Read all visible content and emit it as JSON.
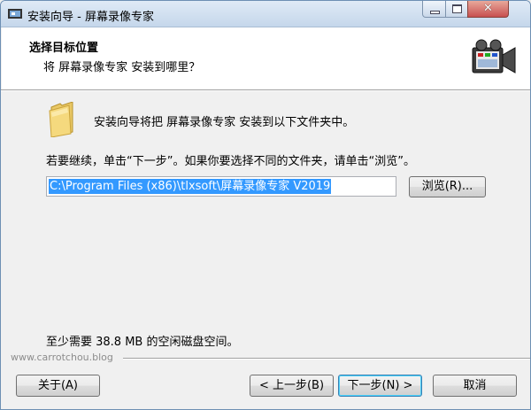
{
  "window": {
    "title": "安装向导 - 屏幕录像专家",
    "controls": {
      "minimize": "minimize-icon",
      "maximize": "maximize-icon",
      "close": "close-icon"
    }
  },
  "header": {
    "title": "选择目标位置",
    "subtitle": "将 屏幕录像专家 安装到哪里？"
  },
  "body": {
    "intro": "安装向导将把 屏幕录像专家 安装到以下文件夹中。",
    "instruction": "若要继续，单击“下一步”。如果你要选择不同的文件夹，请单击“浏览”。",
    "path_value": "C:\\Program Files (x86)\\tlxsoft\\屏幕录像专家 V2019",
    "browse_label": "浏览(R)...",
    "space_text": "至少需要 38.8 MB 的空闲磁盘空间。"
  },
  "watermark": "www.carrotchou.blog",
  "footer": {
    "about_label": "关于(A)",
    "back_label": "< 上一步(B)",
    "next_label": "下一步(N) >",
    "cancel_label": "取消"
  },
  "colors": {
    "selection": "#3399ff",
    "header_bg": "#ffffff",
    "dialog_bg": "#f0f0f0"
  }
}
